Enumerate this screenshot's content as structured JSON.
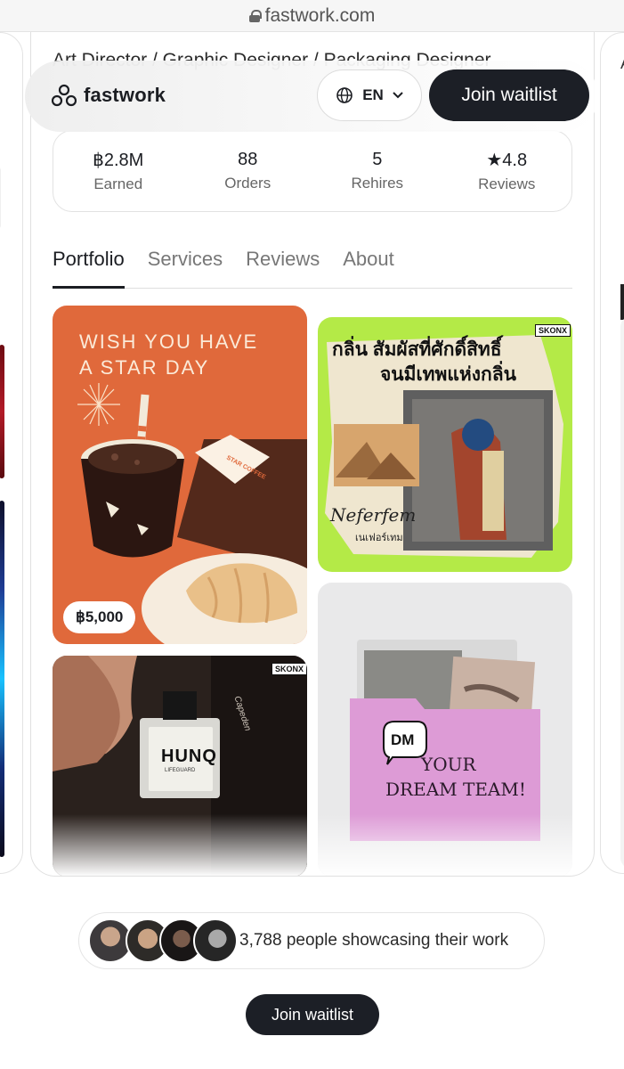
{
  "browser": {
    "url": "fastwork.com"
  },
  "profile": {
    "category_line": "Art Director / Graphic Designer / Packaging Designer"
  },
  "nav": {
    "logo_text": "fastwork",
    "language": "EN",
    "join_label": "Join waitlist"
  },
  "stats": [
    {
      "value": "฿2.8M",
      "label": "Earned"
    },
    {
      "value": "88",
      "label": "Orders"
    },
    {
      "value": "5",
      "label": "Rehires"
    },
    {
      "value": "★4.8",
      "label": "Reviews"
    }
  ],
  "tabs": [
    {
      "label": "Portfolio",
      "active": true
    },
    {
      "label": "Services",
      "active": false
    },
    {
      "label": "Reviews",
      "active": false
    },
    {
      "label": "About",
      "active": false
    }
  ],
  "portfolio": {
    "item1": {
      "headline_l1": "WISH YOU HAVE",
      "headline_l2": "A STAR DAY",
      "cup_text": "STAR COFFEE",
      "price": "฿5,000"
    },
    "item2": {
      "brand": "SKONX",
      "thai_l1": "กลิ่น สัมผัสที่ศักดิ์สิทธิ์",
      "thai_l2": "จนมีเทพแห่งกลิ่น",
      "script": "Neferfem",
      "thai_small": "เนเฟอร์เทม"
    },
    "item3": {
      "brand": "SKONX",
      "bottle": "HUNQ",
      "bottle_sub": "LIFEGUARD",
      "script_side": "Capeden"
    },
    "item4": {
      "dm": "DM",
      "line1": "YOUR",
      "line2": "DREAM TEAM!"
    }
  },
  "showcase": {
    "text": "3,788 people showcasing their work"
  },
  "footer": {
    "join_label": "Join waitlist"
  }
}
